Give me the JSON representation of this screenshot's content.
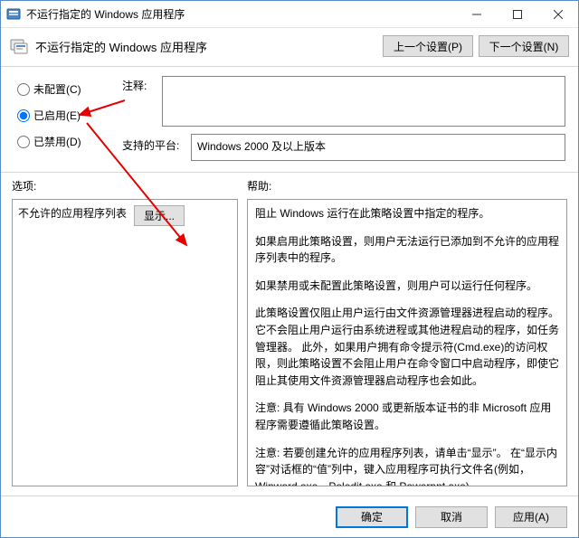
{
  "window": {
    "title": "不运行指定的 Windows 应用程序"
  },
  "header": {
    "title": "不运行指定的 Windows 应用程序",
    "prev": "上一个设置(P)",
    "next": "下一个设置(N)"
  },
  "state": {
    "not_configured": "未配置(C)",
    "enabled": "已启用(E)",
    "disabled": "已禁用(D)",
    "selected": "enabled"
  },
  "fields": {
    "comment_label": "注释:",
    "comment_value": "",
    "platform_label": "支持的平台:",
    "platform_value": "Windows 2000 及以上版本"
  },
  "labels": {
    "options": "选项:",
    "help": "帮助:"
  },
  "options_panel": {
    "list_label": "不允许的应用程序列表",
    "show_button": "显示..."
  },
  "help_paragraphs": [
    "阻止 Windows 运行在此策略设置中指定的程序。",
    "如果启用此策略设置，则用户无法运行已添加到不允许的应用程序列表中的程序。",
    "如果禁用或未配置此策略设置，则用户可以运行任何程序。",
    "此策略设置仅阻止用户运行由文件资源管理器进程启动的程序。它不会阻止用户运行由系统进程或其他进程启动的程序，如任务管理器。 此外，如果用户拥有命令提示符(Cmd.exe)的访问权限，则此策略设置不会阻止用户在命令窗口中启动程序，即使它阻止其使用文件资源管理器启动程序也会如此。",
    "注意: 具有 Windows 2000 或更新版本证书的非 Microsoft 应用程序需要遵循此策略设置。",
    "注意: 若要创建允许的应用程序列表，请单击“显示”。 在“显示内容”对话框的“值”列中，键入应用程序可执行文件名(例如，Winword.exe、Poledit.exe 和 Powerpnt.exe)。"
  ],
  "footer": {
    "ok": "确定",
    "cancel": "取消",
    "apply": "应用(A)"
  }
}
